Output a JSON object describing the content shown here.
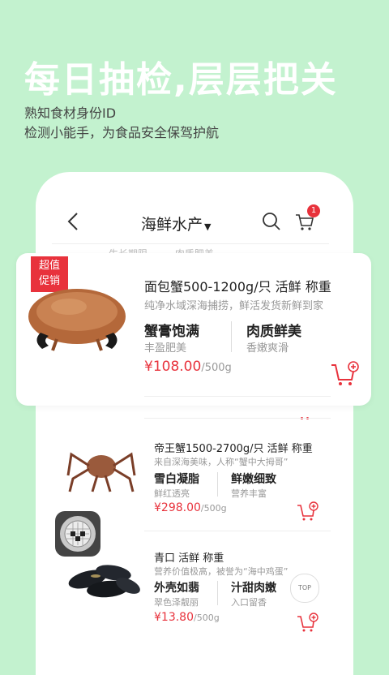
{
  "banner": {
    "headline": "每日抽检,层层把关",
    "sub1": "熟知食材身份ID",
    "sub2": "检测小能手，为食品安全保驾护航"
  },
  "nav": {
    "title": "海鲜水产",
    "cart_count": "1"
  },
  "tabs_peek": [
    "生长期限",
    "肉质肥美"
  ],
  "featured": {
    "promo_line1": "超值",
    "promo_line2": "促销",
    "name": "面包蟹500-1200g/只 活鲜 称重",
    "desc": "纯净水域深海捕捞，鲜活发货新鲜到家",
    "feat1": "蟹膏饱满",
    "feat1_sub": "丰盈肥美",
    "feat2": "肉质鲜美",
    "feat2_sub": "香嫩爽滑",
    "price": "¥108.00",
    "unit": "/500g"
  },
  "items": [
    {
      "name": "帝王蟹1500-2700g/只 活鲜 称重",
      "desc": "来自深海美味，人称“蟹中大拇哥”",
      "feat1": "雪白凝脂",
      "feat1_sub": "鲜红透亮",
      "feat2": "鲜嫩细致",
      "feat2_sub": "营养丰富",
      "price": "¥298.00",
      "unit": "/500g"
    },
    {
      "name": "青口 活鲜 称重",
      "desc": "营养价值极高，被誉为“海中鸡蛋”",
      "feat1": "外壳如翡",
      "feat1_sub": "翠色泽靓丽",
      "feat2": "汁甜肉嫩",
      "feat2_sub": "入口留香",
      "price": "¥13.80",
      "unit": "/500g"
    }
  ],
  "top_button": "TOP",
  "colors": {
    "accent": "#e8323c",
    "background": "#c3f2cf"
  }
}
